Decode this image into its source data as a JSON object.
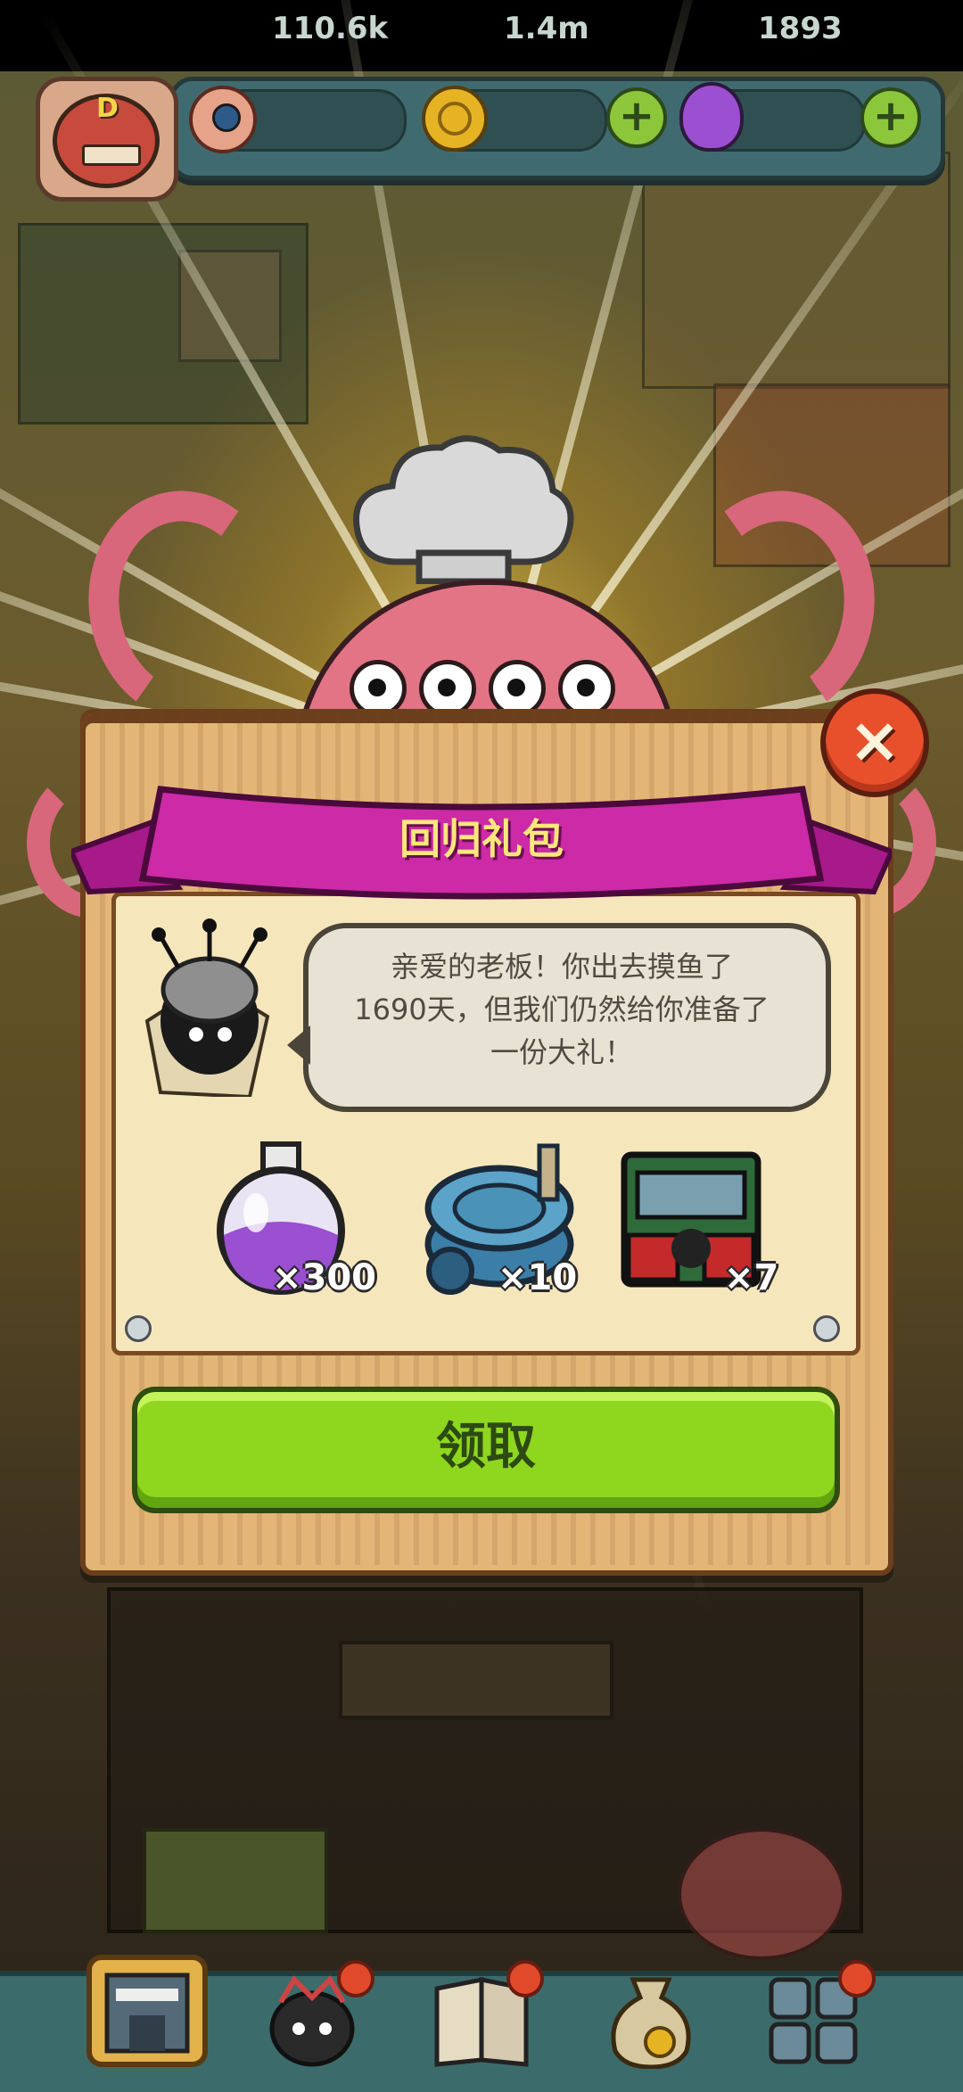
{
  "resources": {
    "eyes": {
      "value": "110.6k",
      "icon": "eyeball-icon",
      "color": "#e08a6a"
    },
    "coins": {
      "value": "1.4m",
      "icon": "coin-icon",
      "color": "#e6b325"
    },
    "potions": {
      "value": "1893",
      "icon": "potion-icon",
      "color": "#9b4fd1"
    }
  },
  "dialog": {
    "title": "回归礼包",
    "message_lines": [
      "亲爱的老板！你出去摸鱼了",
      "1690天，但我们仍然给你准备了",
      "一份大礼！"
    ],
    "rewards": [
      {
        "icon": "purple-potion-icon",
        "count": "×300"
      },
      {
        "icon": "blue-drum-icon",
        "count": "×10"
      },
      {
        "icon": "green-cabinet-icon",
        "count": "×7"
      }
    ],
    "claim_label": "领取",
    "close_icon": "close-icon"
  },
  "colors": {
    "banner": "#cc2aa6",
    "claim_button": "#8fd61e",
    "close_button": "#e8502c",
    "panel": "#e3b677"
  },
  "bottom_nav": {
    "items": [
      {
        "icon": "restaurant-icon",
        "active": true
      },
      {
        "icon": "monster-chef-icon",
        "badge": true
      },
      {
        "icon": "book-icon",
        "badge": true
      },
      {
        "icon": "money-bag-icon"
      },
      {
        "icon": "grid-menu-icon",
        "badge": true
      }
    ]
  }
}
